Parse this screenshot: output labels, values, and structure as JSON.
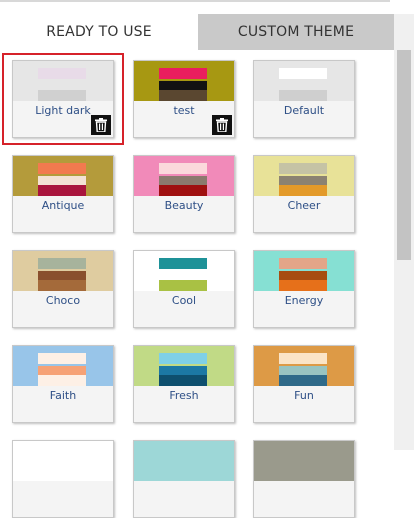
{
  "tabs": {
    "ready": "READY TO USE",
    "custom": "CUSTOM THEME"
  },
  "themes": [
    {
      "name": "Light dark",
      "top": "#e6e6e6",
      "stripes": [
        "#e8dbe8",
        "#e6e6e6",
        "#d0d0d0"
      ],
      "deletable": true,
      "selected": true
    },
    {
      "name": "test",
      "top": "#a79812",
      "stripes": [
        "#ea1e5e",
        "#121212",
        "#5a4730"
      ],
      "deletable": true,
      "selected": false
    },
    {
      "name": "Default",
      "top": "#e6e6e6",
      "stripes": [
        "#ffffff",
        "#e6e6e6",
        "#cfcfcf"
      ],
      "deletable": false,
      "selected": false
    },
    {
      "name": "Antique",
      "top": "#b49b3b",
      "stripes": [
        "#f27a4f",
        "#f3e2d4",
        "#a9153d"
      ],
      "deletable": false,
      "selected": false
    },
    {
      "name": "Beauty",
      "top": "#f18ab9",
      "stripes": [
        "#fbd9dc",
        "#8b7a6e",
        "#9f1010"
      ],
      "deletable": false,
      "selected": false
    },
    {
      "name": "Cheer",
      "top": "#e8e298",
      "stripes": [
        "#c5c3a5",
        "#8b8272",
        "#e39a2a"
      ],
      "deletable": false,
      "selected": false
    },
    {
      "name": "Choco",
      "top": "#dfcca0",
      "stripes": [
        "#a7b39c",
        "#894f2d",
        "#a46a3a"
      ],
      "deletable": false,
      "selected": false
    },
    {
      "name": "Cool",
      "top": "#ffffff",
      "stripes": [
        "#1e9298",
        "#ffffff",
        "#a9c144"
      ],
      "deletable": false,
      "selected": false
    },
    {
      "name": "Energy",
      "top": "#86e0d3",
      "stripes": [
        "#e3a588",
        "#a74d10",
        "#e6701a"
      ],
      "deletable": false,
      "selected": false
    },
    {
      "name": "Faith",
      "top": "#98c5e9",
      "stripes": [
        "#fdf0e6",
        "#f6a276",
        "#fdf0e6"
      ],
      "deletable": false,
      "selected": false
    },
    {
      "name": "Fresh",
      "top": "#c1da86",
      "stripes": [
        "#7fd0e7",
        "#1c78a4",
        "#0e4f6e"
      ],
      "deletable": false,
      "selected": false
    },
    {
      "name": "Fun",
      "top": "#dd9a46",
      "stripes": [
        "#fbe4c7",
        "#99c4c1",
        "#2f6a89"
      ],
      "deletable": false,
      "selected": false
    },
    {
      "name": "",
      "top": "#ffffff",
      "stripes": [
        "#ffffff",
        "#ffffff",
        "#ffffff"
      ],
      "deletable": false,
      "selected": false
    },
    {
      "name": "",
      "top": "#9dd7d7",
      "stripes": [
        "#9dd7d7",
        "#9dd7d7",
        "#9dd7d7"
      ],
      "deletable": false,
      "selected": false
    },
    {
      "name": "",
      "top": "#9a9a8c",
      "stripes": [
        "#9a9a8c",
        "#9a9a8c",
        "#9a9a8c"
      ],
      "deletable": false,
      "selected": false
    }
  ]
}
